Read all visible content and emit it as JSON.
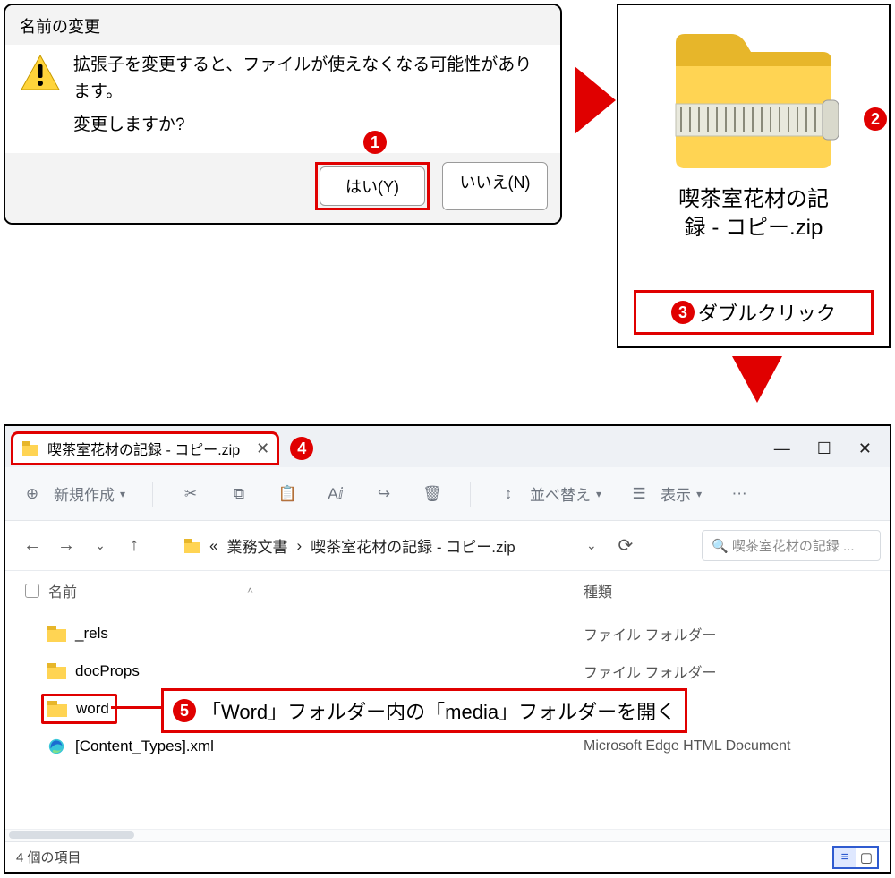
{
  "dialog": {
    "title": "名前の変更",
    "line1": "拡張子を変更すると、ファイルが使えなくなる可能性があります。",
    "line2": "変更しますか?",
    "yes": "はい(Y)",
    "no": "いいえ(N)"
  },
  "zip": {
    "filename_l1": "喫茶室花材の記",
    "filename_l2": "録 - コピー.zip",
    "instruction": "ダブルクリック"
  },
  "explorer": {
    "tab_title": "喫茶室花材の記録 - コピー.zip",
    "toolbar": {
      "new": "新規作成",
      "sort": "並べ替え",
      "view": "表示"
    },
    "breadcrumb": {
      "root": "業務文書",
      "leaf": "喫茶室花材の記録 - コピー.zip",
      "prefix": "«"
    },
    "search_placeholder": "喫茶室花材の記録 ...",
    "columns": {
      "name": "名前",
      "type": "種類"
    },
    "rows": [
      {
        "name": "_rels",
        "type": "ファイル フォルダー",
        "kind": "folder"
      },
      {
        "name": "docProps",
        "type": "ファイル フォルダー",
        "kind": "folder"
      },
      {
        "name": "word",
        "type": "",
        "kind": "folder",
        "highlight": true
      },
      {
        "name": "[Content_Types].xml",
        "type": "Microsoft Edge HTML Document",
        "kind": "edge"
      }
    ],
    "callout": "「Word」フォルダー内の「media」フォルダーを開く",
    "status": "4 個の項目"
  },
  "badges": {
    "b1": "1",
    "b2": "2",
    "b3": "3",
    "b4": "4",
    "b5": "5"
  }
}
